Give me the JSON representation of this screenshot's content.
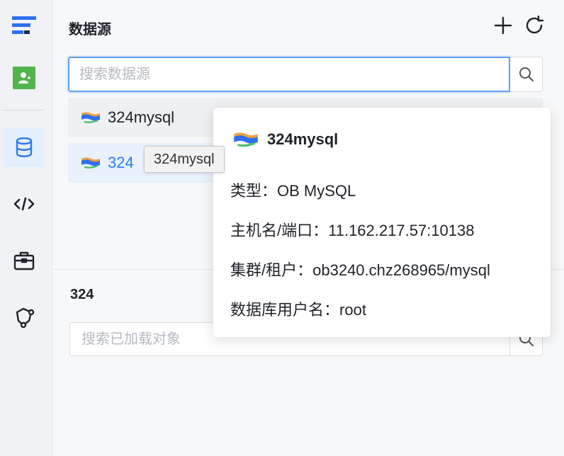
{
  "sidebar": {
    "icons": [
      "logo-icon",
      "user-avatar-icon",
      "database-icon",
      "code-icon",
      "toolbox-icon",
      "network-icon"
    ]
  },
  "panel": {
    "title": "数据源",
    "search_placeholder": "搜索数据源",
    "datasources": [
      {
        "name": "324mysql"
      },
      {
        "name": "324"
      }
    ],
    "selected_name": "324",
    "object_search_placeholder": "搜索已加载对象"
  },
  "tooltip": {
    "text": "324mysql"
  },
  "popover": {
    "name": "324mysql",
    "rows": [
      {
        "label": "类型：",
        "value": "OB MySQL"
      },
      {
        "label": "主机名/端口：",
        "value": "11.162.217.57:10138"
      },
      {
        "label": "集群/租户：",
        "value": "ob3240.chz268965/mysql"
      },
      {
        "label": "数据库用户名：",
        "value": "root"
      }
    ]
  },
  "colors": {
    "accent": "#2e7be6",
    "avatar_green": "#52b44a",
    "focus_border": "#5ea2ed"
  }
}
